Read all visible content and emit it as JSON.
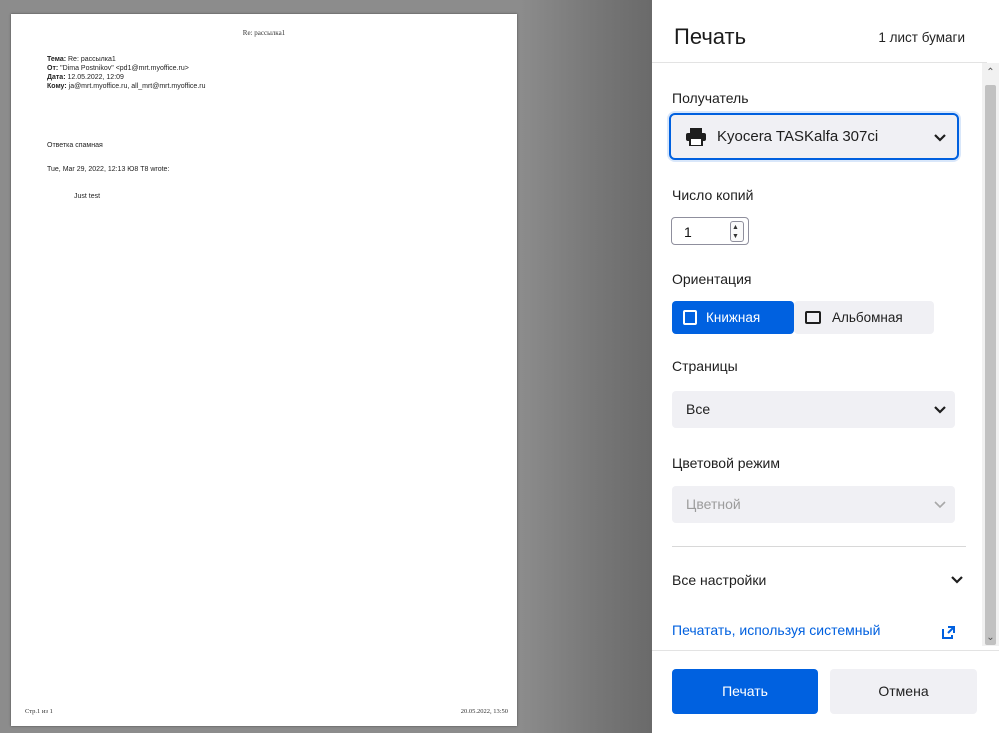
{
  "preview": {
    "page_header": "Re: рассылка1",
    "meta": [
      {
        "key": "Тема:",
        "value": " Re: рассылка1"
      },
      {
        "key": "От:",
        "value": " \"Dima Postnikov\" <pd1@mrt.myoffice.ru>"
      },
      {
        "key": "Дата:",
        "value": " 12.05.2022, 12:09"
      },
      {
        "key": "Кому:",
        "value": " ja@mrt.myoffice.ru, all_mrt@mrt.myoffice.ru"
      }
    ],
    "body_line1": "Ответка спамная",
    "body_line2": "Tue, Mar 29, 2022, 12:13 Ю8 T8 wrote:",
    "quote": "Just test",
    "footer_left": "Стр.1 из 1",
    "footer_right": "20.05.2022, 13:50"
  },
  "panel": {
    "title": "Печать",
    "sheet_count": "1 лист бумаги",
    "destination_label": "Получатель",
    "printer_name": "Kyocera TASKalfa 307ci",
    "printer_icon": "printer-icon",
    "copies_label": "Число копий",
    "copies_value": "1",
    "orientation_label": "Ориентация",
    "orientation_portrait": "Книжная",
    "orientation_landscape": "Альбомная",
    "pages_label": "Страницы",
    "pages_value": "Все",
    "color_label": "Цветовой режим",
    "color_value": "Цветной",
    "more_settings": "Все настройки",
    "system_dialog_link": "Печатать, используя системный",
    "print_button": "Печать",
    "cancel_button": "Отмена"
  },
  "colors": {
    "accent": "#0061e0",
    "link": "#0060df",
    "control_bg": "#f0f0f4"
  }
}
